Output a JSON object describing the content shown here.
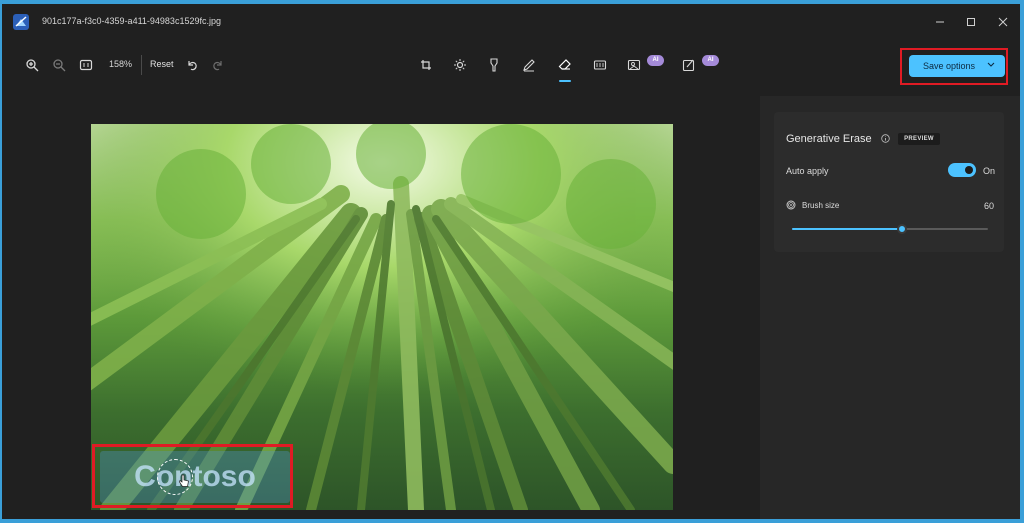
{
  "window": {
    "title": "901c177a-f3c0-4359-a411-94983c1529fc.jpg"
  },
  "toolbar": {
    "zoom_level": "158%",
    "reset_label": "Reset",
    "ai_badge": "AI",
    "save_label": "Save options"
  },
  "canvas": {
    "watermark_text": "Contoso"
  },
  "panel": {
    "title": "Generative Erase",
    "preview_badge": "PREVIEW",
    "auto_apply_label": "Auto apply",
    "auto_apply_state": "On",
    "brush_size_label": "Brush size",
    "brush_size_value": "60",
    "brush_size_fraction": 0.56
  },
  "colors": {
    "accent": "#4cc2ff",
    "highlight_frame": "#e01b24",
    "ai_badge": "#a48ad8"
  }
}
